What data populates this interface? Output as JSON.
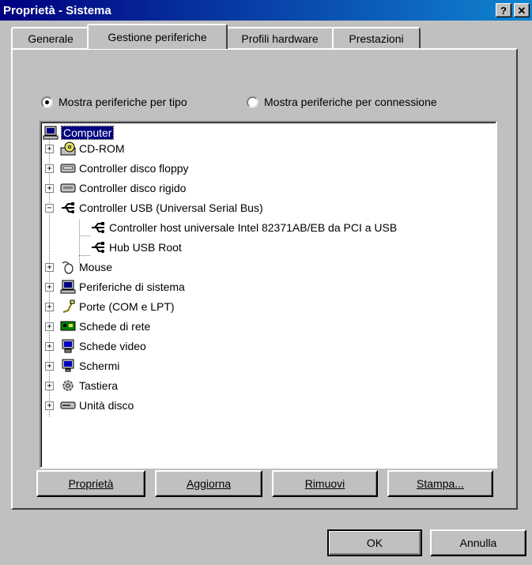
{
  "window": {
    "title": "Proprietà - Sistema",
    "help_label": "?",
    "close_label": "✕"
  },
  "tabs": [
    {
      "label": "Generale"
    },
    {
      "label": "Gestione periferiche"
    },
    {
      "label": "Profili hardware"
    },
    {
      "label": "Prestazioni"
    }
  ],
  "view_options": {
    "by_type_label": "Mostra periferiche per tipo",
    "by_connection_label": "Mostra periferiche per connessione",
    "selected": "by_type"
  },
  "tree": {
    "root": "Computer",
    "items": [
      {
        "label": "CD-ROM",
        "icon": "cdrom-icon"
      },
      {
        "label": "Controller disco floppy",
        "icon": "floppy-controller-icon"
      },
      {
        "label": "Controller disco rigido",
        "icon": "hard-disk-controller-icon"
      },
      {
        "label": "Controller USB (Universal Serial Bus)",
        "icon": "usb-icon",
        "children": [
          {
            "label": "Controller host universale Intel 82371AB/EB da PCI a USB"
          },
          {
            "label": "Hub USB Root"
          }
        ]
      },
      {
        "label": "Mouse",
        "icon": "mouse-icon"
      },
      {
        "label": "Periferiche di sistema",
        "icon": "system-devices-icon"
      },
      {
        "label": "Porte (COM e LPT)",
        "icon": "ports-icon"
      },
      {
        "label": "Schede di rete",
        "icon": "network-card-icon"
      },
      {
        "label": "Schede video",
        "icon": "video-card-icon"
      },
      {
        "label": "Schermi",
        "icon": "monitor-icon"
      },
      {
        "label": "Tastiera",
        "icon": "keyboard-icon"
      },
      {
        "label": "Unità disco",
        "icon": "disk-drive-icon"
      }
    ]
  },
  "buttons": {
    "properties": "Proprietà",
    "refresh": "Aggiorna",
    "remove": "Rimuovi",
    "print": "Stampa...",
    "ok": "OK",
    "cancel": "Annulla"
  }
}
